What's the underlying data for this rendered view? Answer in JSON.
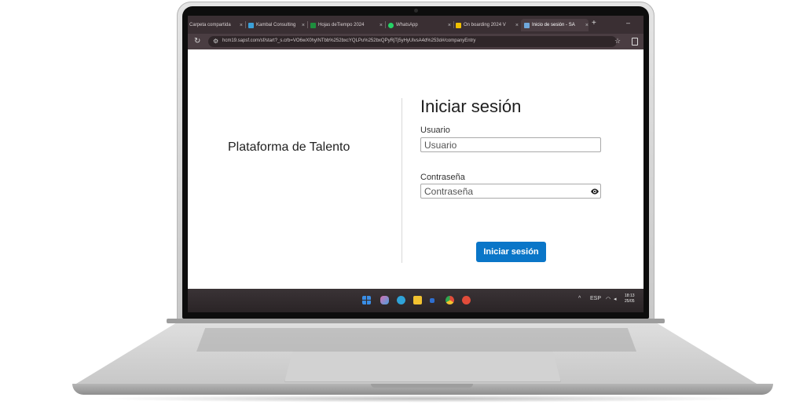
{
  "browser": {
    "tabs": [
      {
        "label": "Carpeta compartida",
        "active": false,
        "icon": "folder-icon",
        "color": "#f0c000"
      },
      {
        "label": "Kambal Consulting",
        "active": false,
        "icon": "site-icon",
        "color": "#3ba0d8"
      },
      {
        "label": "Hojas deTiempo 2024",
        "active": false,
        "icon": "sheets-icon",
        "color": "#1e8e3e"
      },
      {
        "label": "WhatsApp",
        "active": false,
        "icon": "whatsapp-icon",
        "color": "#25d366"
      },
      {
        "label": "On boarding 2024 V",
        "active": false,
        "icon": "folder-icon",
        "color": "#f0c000"
      },
      {
        "label": "Inicio de sesión - SA",
        "active": true,
        "icon": "site-icon",
        "color": "#6fa8dc"
      }
    ],
    "new_tab": "+",
    "minimize": "–",
    "url": "hcm19.sapsf.com/sf/start?_s.crb=VO6wX0hyINTbb%252bxcYQLPu%252bxQPyRjTj5yHyUlvsA4d%253d#/companyEntry"
  },
  "page": {
    "platform_title": "Plataforma de Talento",
    "form_title": "Iniciar sesión",
    "username_label": "Usuario",
    "username_placeholder": "Usuario",
    "password_label": "Contraseña",
    "password_placeholder": "Contraseña",
    "submit_label": "Iniciar sesión",
    "accent_color": "#0a76c8"
  },
  "taskbar": {
    "icons": [
      {
        "name": "windows-start-icon",
        "color": "#3a8ee6"
      },
      {
        "name": "copilot-icon",
        "color": "#d86fb0"
      },
      {
        "name": "edge-icon",
        "color": "#2fa3d8"
      },
      {
        "name": "file-explorer-icon",
        "color": "#f2c230"
      },
      {
        "name": "app-icon",
        "color": "#2f6fd0"
      },
      {
        "name": "chrome-icon",
        "color": "#2fa84f"
      },
      {
        "name": "app-red-icon",
        "color": "#e24c3a"
      }
    ],
    "tray_chevron": "^",
    "language": "ESP",
    "time": "18:13",
    "date": "25/05"
  }
}
